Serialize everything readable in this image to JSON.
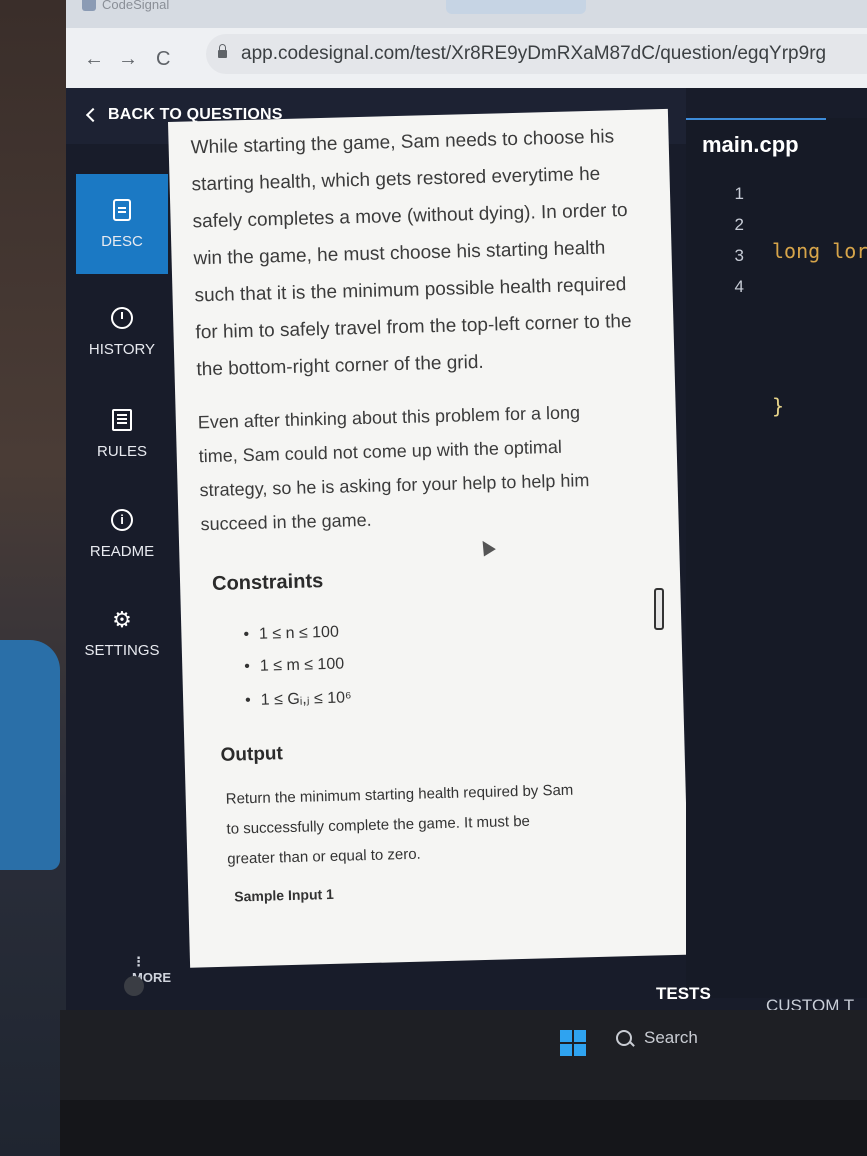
{
  "browser": {
    "tab_title": "CodeSignal",
    "url": "app.codesignal.com/test/Xr8RE9yDmRXaM87dC/question/egqYrp9rg"
  },
  "header": {
    "back_label": "BACK TO QUESTIONS"
  },
  "sidebar": {
    "items": [
      {
        "label": "DESC",
        "icon": "document-icon"
      },
      {
        "label": "HISTORY",
        "icon": "clock-icon"
      },
      {
        "label": "RULES",
        "icon": "list-icon"
      },
      {
        "label": "README",
        "icon": "info-icon"
      },
      {
        "label": "SETTINGS",
        "icon": "gear-icon"
      }
    ],
    "more_label": "⋮ MORE"
  },
  "description": {
    "para1": [
      "While starting the game, Sam needs to choose his",
      "starting health, which gets restored everytime he",
      "safely completes a move (without dying). In order to",
      "win the game, he must choose his starting health",
      "such that it is the minimum possible health required",
      "for him to safely travel from the top-left corner to the",
      "the bottom-right corner of the grid."
    ],
    "para2": [
      "Even after thinking about this problem for a long",
      "time, Sam could not come up with the optimal",
      "strategy, so he is asking for your help to help him",
      "succeed in the game."
    ],
    "constraints_heading": "Constraints",
    "constraints": [
      "1 ≤ n ≤ 100",
      "1 ≤ m ≤ 100",
      "1 ≤ Gᵢ,ⱼ ≤ 10⁶"
    ],
    "output_heading": "Output",
    "output_text": [
      "Return the minimum starting health required by Sam",
      "to successfully complete the game. It must be",
      "greater than or equal to zero."
    ],
    "sample_label": "Sample Input 1"
  },
  "editor": {
    "file_name": "main.cpp",
    "line_numbers": [
      "1",
      "2",
      "3",
      "4"
    ],
    "code_lines": [
      "long lor",
      "",
      "}",
      ""
    ]
  },
  "bottom_tabs": {
    "tests": "TESTS",
    "custom": "CUSTOM T"
  },
  "taskbar": {
    "search_label": "Search"
  }
}
